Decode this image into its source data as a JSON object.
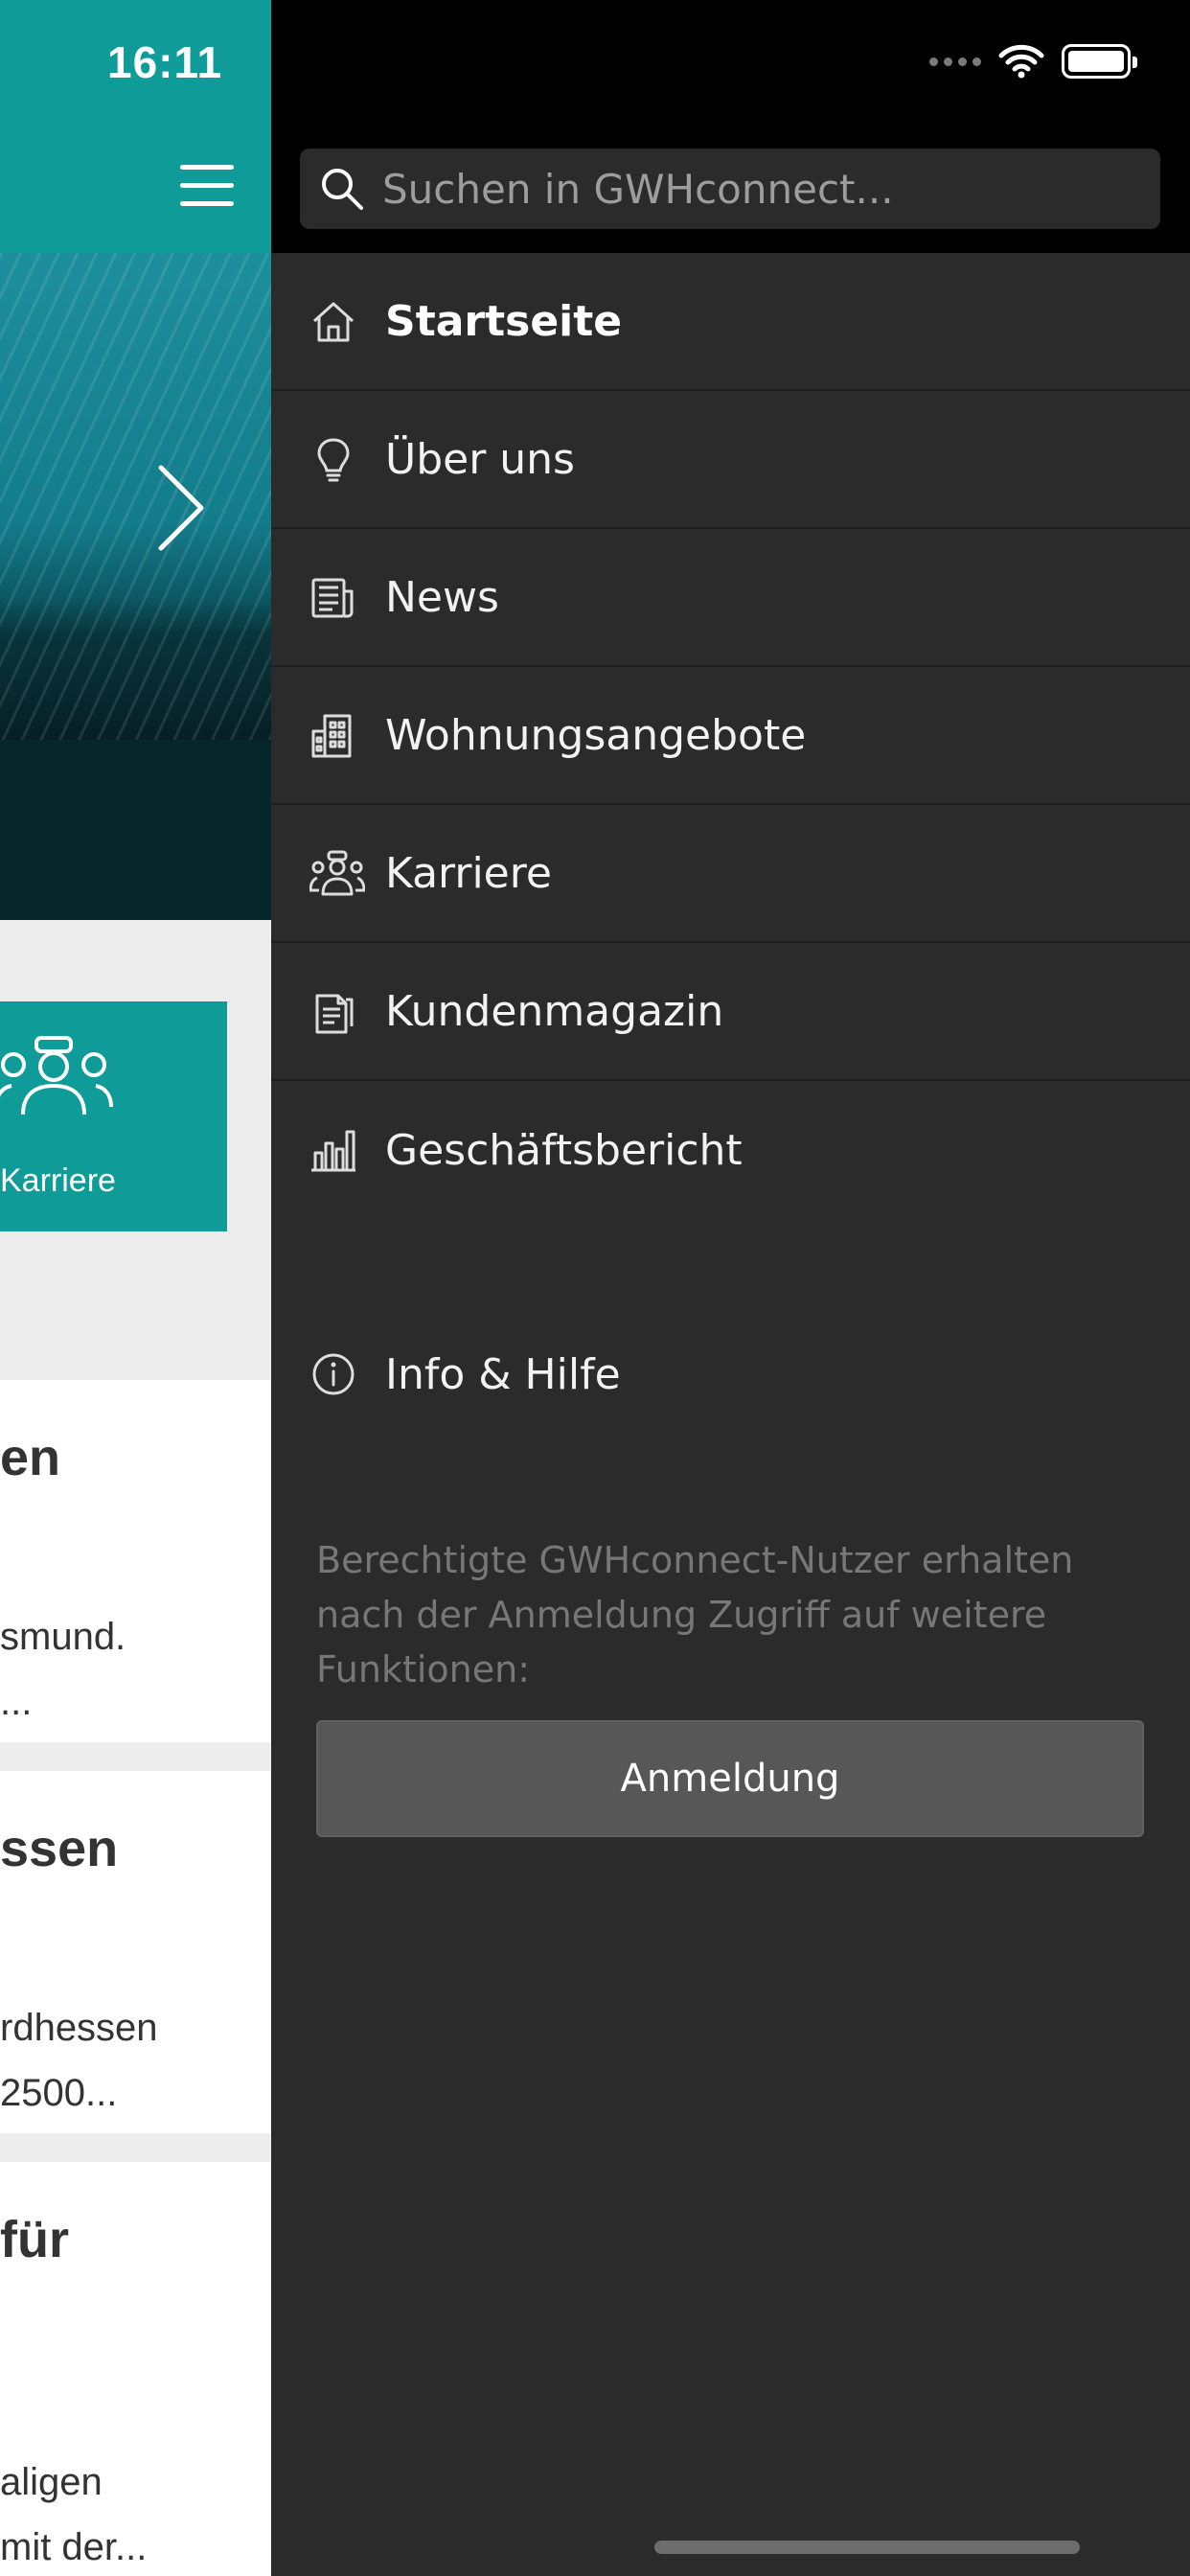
{
  "status_bar": {
    "time": "16:11"
  },
  "background_app": {
    "tile_label": "Karriere",
    "cards": [
      {
        "title": "en",
        "text": "smund.\n..."
      },
      {
        "title": "ssen",
        "text": "rdhessen\n2500..."
      },
      {
        "title": "für",
        "text": "aligen\nmit der..."
      }
    ]
  },
  "drawer": {
    "search": {
      "placeholder": "Suchen in GWHconnect..."
    },
    "menu": [
      {
        "label": "Startseite",
        "icon": "home-icon",
        "active": true
      },
      {
        "label": "Über uns",
        "icon": "lightbulb-icon"
      },
      {
        "label": "News",
        "icon": "newspaper-icon"
      },
      {
        "label": "Wohnungsangebote",
        "icon": "building-icon"
      },
      {
        "label": "Karriere",
        "icon": "people-icon"
      },
      {
        "label": "Kundenmagazin",
        "icon": "magazine-icon"
      },
      {
        "label": "Geschäftsbericht",
        "icon": "bar-chart-icon"
      }
    ],
    "info": {
      "label": "Info & Hilfe",
      "icon": "info-icon"
    },
    "login_hint": "Berechtigte GWHconnect-Nutzer erhalten nach der Anmeldung Zugriff auf weitere Funktionen:",
    "login_button": "Anmeldung"
  },
  "colors": {
    "accent": "#0f9b98",
    "drawer_bg": "#2b2b2b",
    "topbar_bg": "#000000",
    "button_bg": "#575757"
  }
}
